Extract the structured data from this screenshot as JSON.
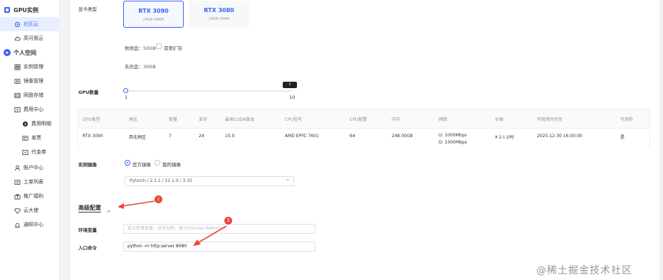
{
  "sidebar": {
    "gpu_section": "GPU实例",
    "community_cloud": "社区云",
    "high_availability": "高可用云",
    "personal_space": "个人空间",
    "instance_mgmt": "实例管理",
    "image_mgmt": "镜像管理",
    "net_storage": "网盘存储",
    "billing_center": "费用中心",
    "billing_detail": "费用明细",
    "invoice": "发票",
    "voucher": "代金券",
    "account_center": "账户中心",
    "ticket_list": "工单列表",
    "promo": "推广福利",
    "cloud_ambassador": "云大使",
    "notifications": "通知中心"
  },
  "form": {
    "gpu_type_label": "显卡类型",
    "gpu_options": [
      {
        "name": "RTX 3090",
        "vram": "24GB VRAM"
      },
      {
        "name": "RTX 3080",
        "vram": "16GB VRAM"
      }
    ],
    "data_disk": "数据盘：50GB",
    "expand_label": "需要扩容",
    "system_disk": "系统盘：30GB",
    "gpu_count_label": "GPU数量",
    "slider_min": "1",
    "slider_max": "10",
    "slider_tip": "1",
    "slider_value": 0,
    "image_label": "实例镜像",
    "image_official": "官方镜像",
    "image_mine": "我的镜像",
    "image_select": "Pytorch / 2.1.1 / 12.1.0 / 3.10",
    "advanced_title": "高级配置",
    "env_label": "环境变量",
    "env_placeholder": "定义环境变量，分号分割，如:FOO=bar;BAR=foo",
    "entry_label": "入口命令",
    "entry_value": "python -m http.server 8080"
  },
  "table": {
    "headers": [
      "GPU类型",
      "地区",
      "数量",
      "显存",
      "最高CUDA版本",
      "CPU型号",
      "CPU配置",
      "内存",
      "网络",
      "价格",
      "可租用时间至",
      "可用券"
    ],
    "row": [
      "RTX 3090",
      "西北地区",
      "7",
      "24",
      "15.0",
      "AMD EPYC 7601",
      "64",
      "248.00GB",
      "U: 1000Mbps",
      "¥ 2 (-)/时",
      "2025-12-30 16:00:00",
      "是"
    ],
    "network_down": "D: 1000Mbps"
  },
  "annotations": {
    "badge1": "1",
    "badge2": "2",
    "color": "#e8483a"
  },
  "watermark": "@稀土掘金技术社区",
  "colors": {
    "accent": "#3b64f5",
    "annotation": "#e8483a"
  }
}
